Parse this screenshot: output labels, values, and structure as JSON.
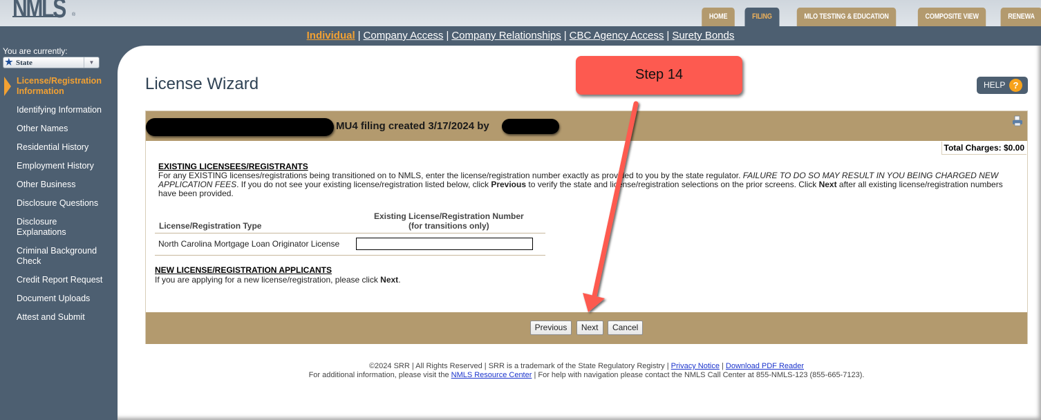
{
  "header": {
    "logo_text": "NMLS",
    "logo_reg": "®",
    "main_tabs": [
      {
        "label": "HOME",
        "active": false
      },
      {
        "label": "FILING",
        "active": true
      },
      {
        "label": "MLO TESTING & EDUCATION",
        "active": false
      },
      {
        "label": "COMPOSITE VIEW",
        "active": false
      },
      {
        "label": "RENEWA",
        "active": false
      }
    ],
    "subnav": [
      {
        "label": "Individual",
        "active": true
      },
      {
        "label": "Company Access",
        "active": false
      },
      {
        "label": "Company Relationships",
        "active": false
      },
      {
        "label": "CBC Agency Access",
        "active": false
      },
      {
        "label": "Surety Bonds",
        "active": false
      }
    ],
    "subnav_separator": "|"
  },
  "sidebar": {
    "you_are_currently": "You are currently:",
    "role_select": {
      "value": "State",
      "icon": "star-icon"
    },
    "items": [
      {
        "label": "License/Registration Information",
        "active": true
      },
      {
        "label": "Identifying Information",
        "active": false
      },
      {
        "label": "Other Names",
        "active": false
      },
      {
        "label": "Residential History",
        "active": false
      },
      {
        "label": "Employment History",
        "active": false
      },
      {
        "label": "Other Business",
        "active": false
      },
      {
        "label": "Disclosure Questions",
        "active": false
      },
      {
        "label": "Disclosure Explanations",
        "active": false
      },
      {
        "label": "Criminal Background Check",
        "active": false
      },
      {
        "label": "Credit Report Request",
        "active": false
      },
      {
        "label": "Document Uploads",
        "active": false
      },
      {
        "label": "Attest and Submit",
        "active": false
      }
    ]
  },
  "main": {
    "page_title": "License Wizard",
    "help_label": "HELP",
    "help_icon": "?",
    "filing_title": "MU4 filing created 3/17/2024 by",
    "total_charges": "Total Charges: $0.00",
    "existing": {
      "heading": "EXISTING LICENSEES/REGISTRANTS",
      "p1": "For any EXISTING licenses/registrations being transitioned on to NMLS, enter the license/registration number exactly as provided to you by the state regulator. ",
      "p1_italic": "FAILURE TO DO SO MAY RESULT IN YOU BEING CHARGED NEW APPLICATION FEES",
      "p2": ". If you do not see your existing license/registration listed below, click ",
      "p2_bold": "Previous",
      "p3": " to verify the state and license/registration selections on the prior screens. Click ",
      "p3_bold": "Next",
      "p4": " after all existing license/registration numbers have been provided."
    },
    "table": {
      "col_type": "License/Registration Type",
      "col_number_line1": "Existing License/Registration Number",
      "col_number_line2": "(for transitions only)",
      "rows": [
        {
          "type": "North Carolina Mortgage Loan Originator License",
          "number_value": ""
        }
      ]
    },
    "new_applicants": {
      "heading": "NEW LICENSE/REGISTRATION APPLICANTS",
      "text": "If you are applying for a new license/registration, please click ",
      "text_bold": "Next",
      "text_end": "."
    },
    "buttons": {
      "previous": "Previous",
      "next": "Next",
      "cancel": "Cancel"
    }
  },
  "footer": {
    "line1_text": "©2024 SRR | All Rights Reserved | SRR is a trademark of the State Regulatory Registry | ",
    "privacy_link": "Privacy Notice",
    "sep": " | ",
    "pdf_link": "Download PDF Reader",
    "line2_pre": "For additional information, please visit the ",
    "resource_link": "NMLS Resource Center",
    "line2_post": " | For help with navigation please contact the NMLS Call Center at 855-NMLS-123 (855-665-7123)."
  },
  "annotation": {
    "step_label": "Step 14",
    "color": "#fd5a50"
  }
}
